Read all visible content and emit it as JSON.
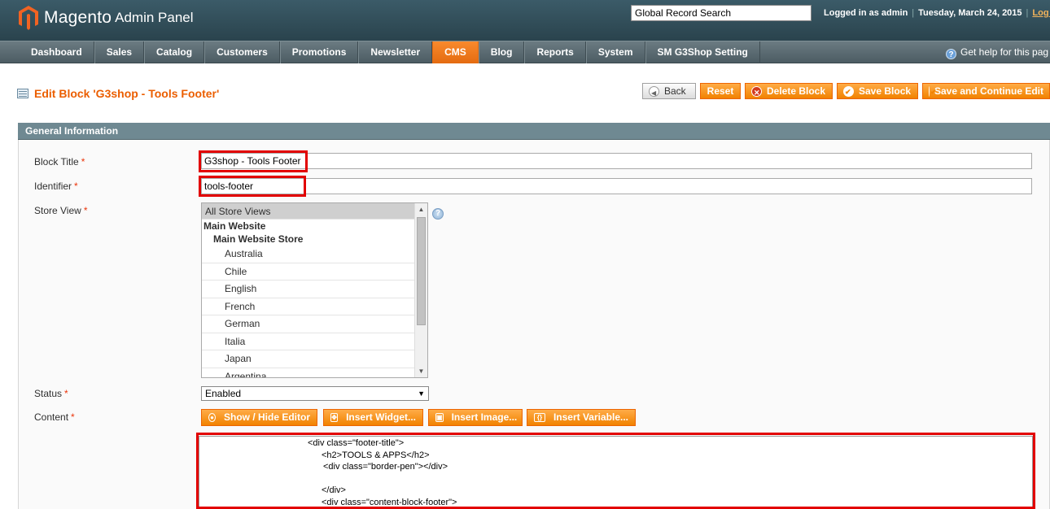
{
  "header": {
    "brand": "Magento",
    "brand_sub": "Admin Panel",
    "search_placeholder": "Global Record Search",
    "logged_in": "Logged in as admin",
    "date": "Tuesday, March 24, 2015",
    "logout": "Log O"
  },
  "nav": {
    "items": [
      "Dashboard",
      "Sales",
      "Catalog",
      "Customers",
      "Promotions",
      "Newsletter",
      "CMS",
      "Blog",
      "Reports",
      "System",
      "SM G3Shop Setting"
    ],
    "active": "CMS",
    "help": "Get help for this pag"
  },
  "page": {
    "title": "Edit Block 'G3shop - Tools Footer'",
    "buttons": {
      "back": "Back",
      "reset": "Reset",
      "delete": "Delete Block",
      "save": "Save Block",
      "save_continue": "Save and Continue Edit"
    }
  },
  "form": {
    "section_title": "General Information",
    "block_title_label": "Block Title",
    "block_title_value": "G3shop - Tools Footer",
    "identifier_label": "Identifier",
    "identifier_value": "tools-footer",
    "store_view_label": "Store View",
    "store_views": {
      "all": "All Store Views",
      "website": "Main Website",
      "store": "Main Website Store",
      "views": [
        "Australia",
        "Chile",
        "English",
        "French",
        "German",
        "Italia",
        "Japan",
        "Argentina"
      ]
    },
    "status_label": "Status",
    "status_value": "Enabled",
    "content_label": "Content",
    "required_mark": "*",
    "editor_buttons": {
      "show_hide": "Show / Hide Editor",
      "widget": "Insert Widget...",
      "image": "Insert Image...",
      "variable": "Insert Variable..."
    },
    "content_lines": [
      "<div class=\"footer-title\">",
      "<h2>TOOLS & APPS</h2>",
      "<div class=\"border-pen\"></div>",
      "",
      "</div>",
      "<div class=\"content-block-footer\">"
    ]
  },
  "colors": {
    "accent": "#eb5e00",
    "button_orange": "#f18200",
    "highlight_red": "#e20000",
    "header_bg": "#2e4a55",
    "section_head": "#6f8992"
  }
}
